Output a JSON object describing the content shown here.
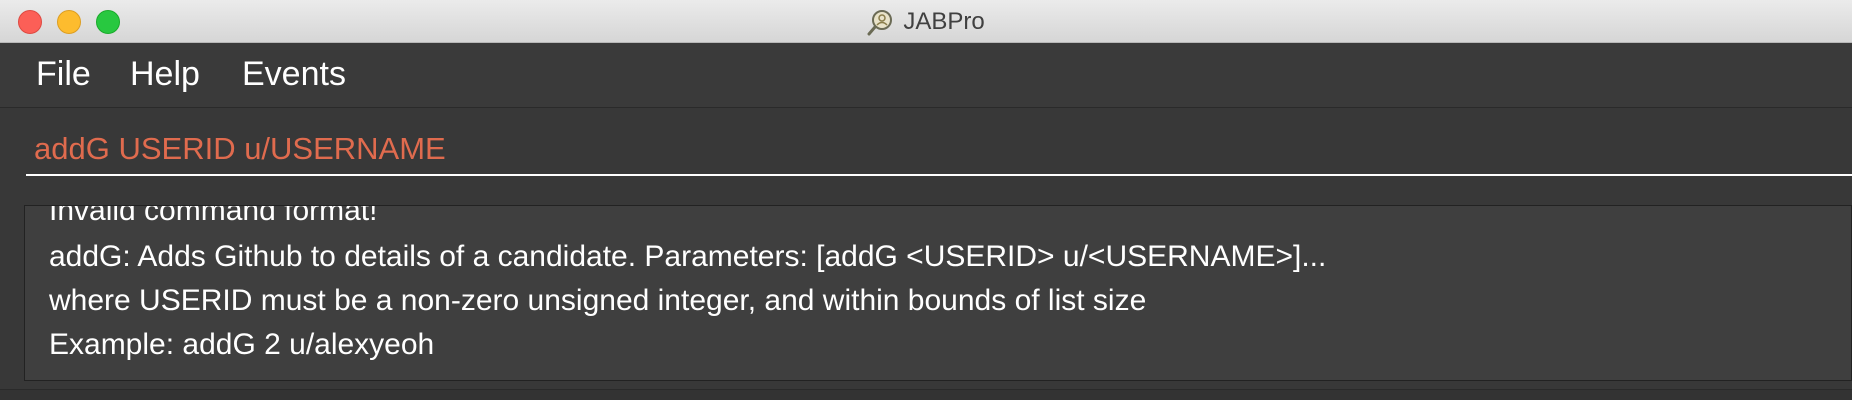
{
  "window": {
    "title": "JABPro",
    "app_icon": "magnifier-icon"
  },
  "menubar": {
    "items": [
      {
        "label": "File"
      },
      {
        "label": "Help"
      },
      {
        "label": "Events"
      }
    ]
  },
  "command_box": {
    "value": "addG USERID u/USERNAME",
    "text_color": "#e06b4e"
  },
  "result_display": {
    "lines": [
      "Invalid command format!",
      "addG: Adds Github to details of a candidate. Parameters: [addG <USERID> u/<USERNAME>]...",
      "where USERID must be a non-zero unsigned integer, and within bounds of list size",
      "Example: addG 2 u/alexyeoh"
    ]
  },
  "colors": {
    "background": "#383838",
    "close": "#fc5f57",
    "minimize": "#fdbc2e",
    "maximize": "#28c840"
  }
}
